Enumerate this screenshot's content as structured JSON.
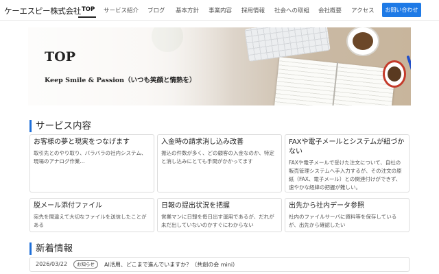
{
  "header": {
    "logo": "ケーエスピー株式会社",
    "nav": [
      {
        "label": "TOP",
        "active": true
      },
      {
        "label": "サービス紹介"
      },
      {
        "label": "ブログ"
      },
      {
        "label": "基本方針"
      },
      {
        "label": "事業内容"
      },
      {
        "label": "採用情報"
      },
      {
        "label": "社会への取組"
      },
      {
        "label": "会社概要"
      },
      {
        "label": "アクセス"
      }
    ],
    "contact_label": "お問い合わせ"
  },
  "hero": {
    "title": "TOP",
    "subtitle": "Keep Smile & Passion（いつも笑顔と情熱を）"
  },
  "services": {
    "heading": "サービス内容",
    "cards": [
      {
        "title": "お客様の夢と現実をつなげます",
        "desc": "取引先とのやり取り、バラバラの社内システム、現場のアナログ作業..."
      },
      {
        "title": "入金時の請求消し込み改善",
        "desc": "振込の件数が多く、どの顧客の入金なのか、特定と消し込みにとても手間がかかってます"
      },
      {
        "title": "FAXや電子メールとシステムが紐づかない",
        "desc": "FAXや電子メールで受けた注文について、自社の販売管理システムへ手入力するが、その注文の原紙（FAX、電子メール）との関連付けができず、速やかな経緯の把握が難しい。"
      },
      {
        "title": "脱メール添付ファイル",
        "desc": "宛先を間違えて大切なファイルを送信したことがある"
      },
      {
        "title": "日報の提出状況を把握",
        "desc": "営業マンに日報を毎日出す運用であるが、だれが未だ出していないのかすぐにわからない"
      },
      {
        "title": "出先から社内データ参照",
        "desc": "社内のファイルサーバに資料等を保存しているが、出先から確認したい"
      }
    ]
  },
  "news": {
    "heading": "新着情報",
    "items": [
      {
        "date": "2026/03/22",
        "badge": "お知らせ",
        "text": "AI活用、どこまで進んでいますか？（共創の会 mini）"
      }
    ]
  },
  "colors": {
    "accent": "#1e7ae6",
    "heading_bar": "#1e6fd9"
  }
}
